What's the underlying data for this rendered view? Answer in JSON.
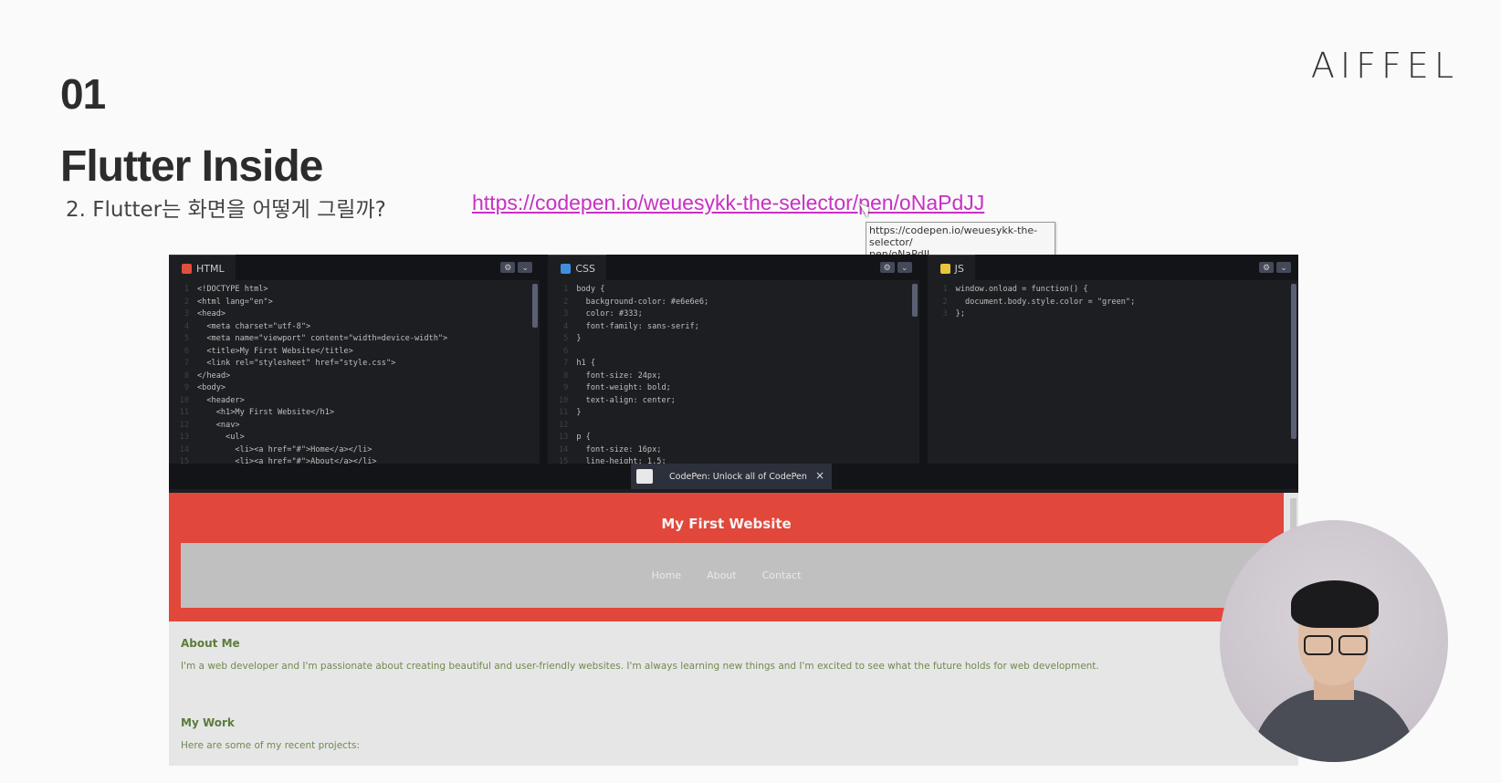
{
  "slide": {
    "number": "01",
    "logo": "AIFFEL",
    "title": "Flutter Inside",
    "subtitle": "2. Flutter는 화면을 어떻게 그릴까?",
    "link_text": "https://codepen.io/weuesykk-the-selector/pen/oNaPdJJ",
    "tooltip_line1": "https://codepen.io/weuesykk-the-selector/",
    "tooltip_line2": "pen/oNaPdJJ"
  },
  "editors": {
    "html": {
      "label": "HTML",
      "icon_color": "#e04f3b",
      "lines": [
        {
          "n": "1",
          "t": "<!DOCTYPE html>"
        },
        {
          "n": "2",
          "t": "<html lang=\"en\">"
        },
        {
          "n": "3",
          "t": "<head>"
        },
        {
          "n": "4",
          "t": "  <meta charset=\"utf-8\">"
        },
        {
          "n": "5",
          "t": "  <meta name=\"viewport\" content=\"width=device-width\">"
        },
        {
          "n": "6",
          "t": "  <title>My First Website</title>"
        },
        {
          "n": "7",
          "t": "  <link rel=\"stylesheet\" href=\"style.css\">"
        },
        {
          "n": "8",
          "t": "</head>"
        },
        {
          "n": "9",
          "t": "<body>"
        },
        {
          "n": "10",
          "t": "  <header>"
        },
        {
          "n": "11",
          "t": "    <h1>My First Website</h1>"
        },
        {
          "n": "12",
          "t": "    <nav>"
        },
        {
          "n": "13",
          "t": "      <ul>"
        },
        {
          "n": "14",
          "t": "        <li><a href=\"#\">Home</a></li>"
        },
        {
          "n": "15",
          "t": "        <li><a href=\"#\">About</a></li>"
        }
      ]
    },
    "css": {
      "label": "CSS",
      "icon_color": "#3f8fe0",
      "lines": [
        {
          "n": "1",
          "t": "body {"
        },
        {
          "n": "2",
          "t": "  background-color: #e6e6e6;"
        },
        {
          "n": "3",
          "t": "  color: #333;"
        },
        {
          "n": "4",
          "t": "  font-family: sans-serif;"
        },
        {
          "n": "5",
          "t": "}"
        },
        {
          "n": "6",
          "t": ""
        },
        {
          "n": "7",
          "t": "h1 {"
        },
        {
          "n": "8",
          "t": "  font-size: 24px;"
        },
        {
          "n": "9",
          "t": "  font-weight: bold;"
        },
        {
          "n": "10",
          "t": "  text-align: center;"
        },
        {
          "n": "11",
          "t": "}"
        },
        {
          "n": "12",
          "t": ""
        },
        {
          "n": "13",
          "t": "p {"
        },
        {
          "n": "14",
          "t": "  font-size: 16px;"
        },
        {
          "n": "15",
          "t": "  line-height: 1.5;"
        }
      ]
    },
    "js": {
      "label": "JS",
      "icon_color": "#e8c63a",
      "lines": [
        {
          "n": "1",
          "t": "window.onload = function() {"
        },
        {
          "n": "2",
          "t": "  document.body.style.color = \"green\";"
        },
        {
          "n": "3",
          "t": "};"
        }
      ]
    },
    "settings_icon": "gear-icon",
    "collapse_icon": "chevron-down-icon"
  },
  "promo": {
    "text": "CodePen: Unlock all of CodePen",
    "close": "×"
  },
  "preview": {
    "h1": "My First Website",
    "nav": [
      "Home",
      "About",
      "Contact"
    ],
    "about_title": "About Me",
    "about_text": "I'm a web developer and I'm passionate about creating beautiful and user-friendly websites. I'm always learning new things and I'm excited to see what the future holds for web development.",
    "work_title": "My Work",
    "work_text": "Here are some of my recent projects:"
  }
}
